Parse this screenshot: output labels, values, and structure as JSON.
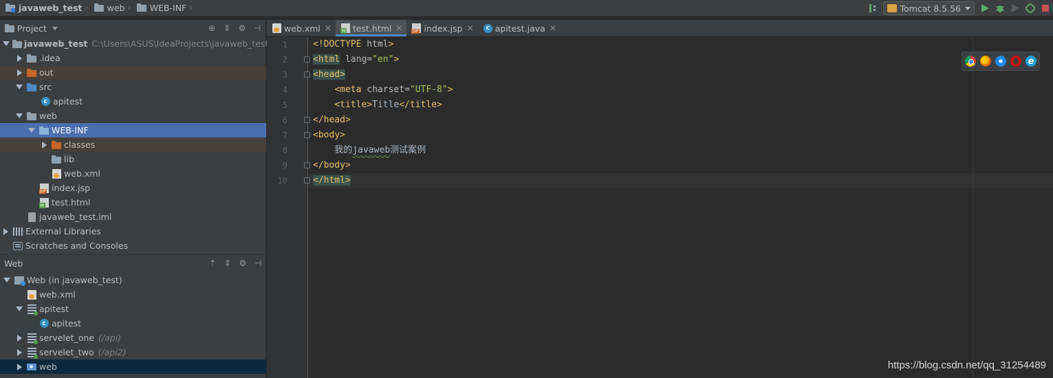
{
  "breadcrumbs": [
    "javaweb_test",
    "web",
    "WEB-INF"
  ],
  "run_config": {
    "label": "Tomcat 8.5.56"
  },
  "project_panel": {
    "title": "Project",
    "tree": [
      {
        "label": "javaweb_test",
        "path": "C:\\Users\\ASUS\\IdeaProjects\\javaweb_test"
      },
      {
        "label": ".idea"
      },
      {
        "label": "out"
      },
      {
        "label": "src"
      },
      {
        "label": "apitest"
      },
      {
        "label": "web"
      },
      {
        "label": "WEB-INF"
      },
      {
        "label": "classes"
      },
      {
        "label": "lib"
      },
      {
        "label": "web.xml"
      },
      {
        "label": "index.jsp"
      },
      {
        "label": "test.html"
      },
      {
        "label": "javaweb_test.iml"
      },
      {
        "label": "External Libraries"
      },
      {
        "label": "Scratches and Consoles"
      }
    ]
  },
  "web_panel": {
    "title": "Web",
    "tree": [
      {
        "label": "Web (in javaweb_test)"
      },
      {
        "label": "web.xml"
      },
      {
        "label": "apitest"
      },
      {
        "label": "apitest"
      },
      {
        "label": "servelet_one",
        "path": "(/api)"
      },
      {
        "label": "servelet_two",
        "path": "(/api2)"
      },
      {
        "label": "web"
      }
    ]
  },
  "tabs": [
    {
      "label": "web.xml",
      "active": false
    },
    {
      "label": "test.html",
      "active": true
    },
    {
      "label": "index.jsp",
      "active": false
    },
    {
      "label": "apitest.java",
      "active": false
    }
  ],
  "editor": {
    "line_numbers": [
      "1",
      "2",
      "3",
      "4",
      "5",
      "6",
      "7",
      "8",
      "9",
      "10"
    ],
    "lines": [
      {
        "parts": [
          [
            "tag",
            "<!DOCTYPE "
          ],
          [
            "attr",
            "html"
          ],
          [
            "tag",
            ">"
          ]
        ]
      },
      {
        "parts": [
          [
            "tag",
            "<html"
          ],
          [
            "attr",
            " lang="
          ],
          [
            "str",
            "\"en\""
          ],
          [
            "tag",
            ">"
          ]
        ]
      },
      {
        "parts": [
          [
            "tag",
            "<head>"
          ]
        ]
      },
      {
        "parts": [
          [
            "txt",
            "    "
          ],
          [
            "tag",
            "<meta"
          ],
          [
            "attr",
            " charset="
          ],
          [
            "str",
            "\"UTF-8\""
          ],
          [
            "tag",
            ">"
          ]
        ]
      },
      {
        "parts": [
          [
            "txt",
            "    "
          ],
          [
            "tag",
            "<title>"
          ],
          [
            "txt",
            "Title"
          ],
          [
            "tag",
            "</title>"
          ]
        ]
      },
      {
        "parts": [
          [
            "tag",
            "</head>"
          ]
        ]
      },
      {
        "parts": [
          [
            "tag",
            "<body>"
          ]
        ]
      },
      {
        "parts": [
          [
            "txt",
            "    我的"
          ],
          [
            "wavy",
            "javaweb"
          ],
          [
            "txt",
            "测试案例"
          ]
        ]
      },
      {
        "parts": [
          [
            "tag",
            "</body>"
          ]
        ]
      },
      {
        "parts": [
          [
            "hltag",
            "</html>"
          ]
        ]
      }
    ]
  },
  "browser_icons": [
    "chrome-icon",
    "firefox-icon",
    "safari-icon",
    "opera-icon",
    "ie-icon"
  ],
  "watermark": "https://blog.csdn.net/qq_31254489"
}
